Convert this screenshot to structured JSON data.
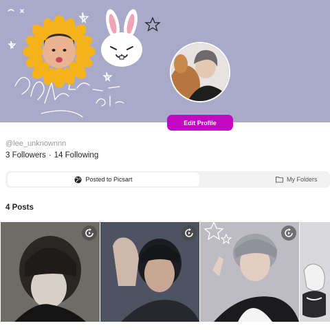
{
  "profile": {
    "edit_label": "Edit Profile",
    "username": "@lee_unknownnn",
    "followers": "3 Followers",
    "separator": "·",
    "following": "14 Following"
  },
  "tabs": {
    "posted_label": "Posted to Picsart",
    "folders_label": "My Folders"
  },
  "posts": {
    "count_label": "4 Posts"
  },
  "colors": {
    "banner": "#a9aac9",
    "accent": "#c209c1"
  },
  "icons": {
    "posted": "picsart-globe-icon",
    "folders": "folder-icon",
    "remix": "remix-icon"
  }
}
